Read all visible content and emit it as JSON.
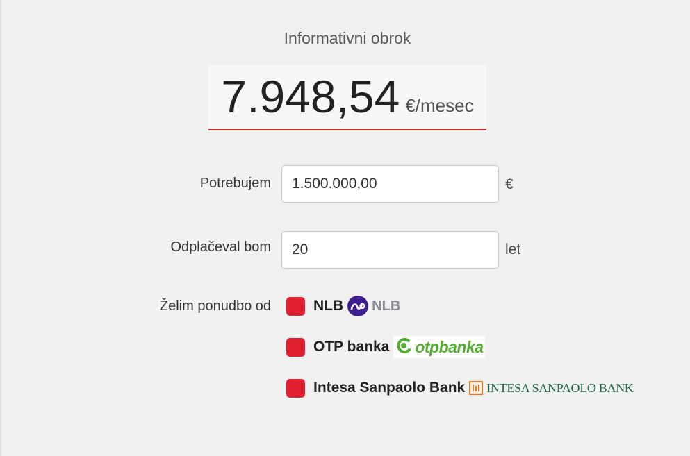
{
  "header": {
    "label": "Informativni obrok"
  },
  "result": {
    "value": "7.948,54",
    "unit": "€/mesec",
    "accent_color": "#c8322d"
  },
  "fields": {
    "amount": {
      "label": "Potrebujem",
      "value": "1.500.000,00",
      "unit": "€"
    },
    "term": {
      "label": "Odplačeval bom",
      "value": "20",
      "unit": "let"
    }
  },
  "offers": {
    "label": "Želim ponudbo od",
    "checkbox_color": "#e02030",
    "banks": [
      {
        "name": "NLB",
        "logo_text": "NLB",
        "logo_icon": "nlb-logo-icon",
        "checked": true
      },
      {
        "name": "OTP banka",
        "logo_text": "otpbanka",
        "logo_icon": "otp-logo-icon",
        "checked": true
      },
      {
        "name": "Intesa Sanpaolo Bank",
        "logo_text": "INTESA SANPAOLO BANK",
        "logo_icon": "intesa-logo-icon",
        "checked": true
      }
    ]
  }
}
